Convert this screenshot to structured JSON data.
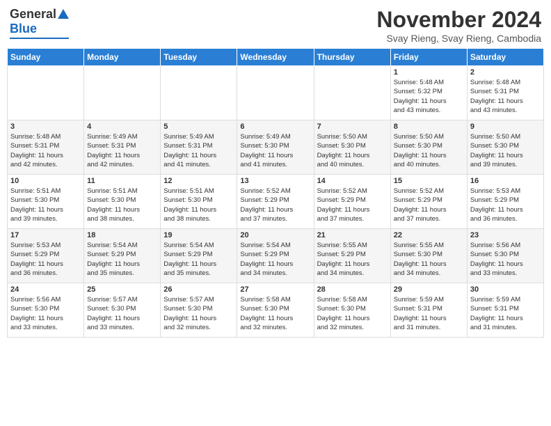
{
  "header": {
    "logo_general": "General",
    "logo_blue": "Blue",
    "month_title": "November 2024",
    "location": "Svay Rieng, Svay Rieng, Cambodia"
  },
  "days_of_week": [
    "Sunday",
    "Monday",
    "Tuesday",
    "Wednesday",
    "Thursday",
    "Friday",
    "Saturday"
  ],
  "weeks": [
    [
      {
        "day": "",
        "info": ""
      },
      {
        "day": "",
        "info": ""
      },
      {
        "day": "",
        "info": ""
      },
      {
        "day": "",
        "info": ""
      },
      {
        "day": "",
        "info": ""
      },
      {
        "day": "1",
        "info": "Sunrise: 5:48 AM\nSunset: 5:32 PM\nDaylight: 11 hours\nand 43 minutes."
      },
      {
        "day": "2",
        "info": "Sunrise: 5:48 AM\nSunset: 5:31 PM\nDaylight: 11 hours\nand 43 minutes."
      }
    ],
    [
      {
        "day": "3",
        "info": "Sunrise: 5:48 AM\nSunset: 5:31 PM\nDaylight: 11 hours\nand 42 minutes."
      },
      {
        "day": "4",
        "info": "Sunrise: 5:49 AM\nSunset: 5:31 PM\nDaylight: 11 hours\nand 42 minutes."
      },
      {
        "day": "5",
        "info": "Sunrise: 5:49 AM\nSunset: 5:31 PM\nDaylight: 11 hours\nand 41 minutes."
      },
      {
        "day": "6",
        "info": "Sunrise: 5:49 AM\nSunset: 5:30 PM\nDaylight: 11 hours\nand 41 minutes."
      },
      {
        "day": "7",
        "info": "Sunrise: 5:50 AM\nSunset: 5:30 PM\nDaylight: 11 hours\nand 40 minutes."
      },
      {
        "day": "8",
        "info": "Sunrise: 5:50 AM\nSunset: 5:30 PM\nDaylight: 11 hours\nand 40 minutes."
      },
      {
        "day": "9",
        "info": "Sunrise: 5:50 AM\nSunset: 5:30 PM\nDaylight: 11 hours\nand 39 minutes."
      }
    ],
    [
      {
        "day": "10",
        "info": "Sunrise: 5:51 AM\nSunset: 5:30 PM\nDaylight: 11 hours\nand 39 minutes."
      },
      {
        "day": "11",
        "info": "Sunrise: 5:51 AM\nSunset: 5:30 PM\nDaylight: 11 hours\nand 38 minutes."
      },
      {
        "day": "12",
        "info": "Sunrise: 5:51 AM\nSunset: 5:30 PM\nDaylight: 11 hours\nand 38 minutes."
      },
      {
        "day": "13",
        "info": "Sunrise: 5:52 AM\nSunset: 5:29 PM\nDaylight: 11 hours\nand 37 minutes."
      },
      {
        "day": "14",
        "info": "Sunrise: 5:52 AM\nSunset: 5:29 PM\nDaylight: 11 hours\nand 37 minutes."
      },
      {
        "day": "15",
        "info": "Sunrise: 5:52 AM\nSunset: 5:29 PM\nDaylight: 11 hours\nand 37 minutes."
      },
      {
        "day": "16",
        "info": "Sunrise: 5:53 AM\nSunset: 5:29 PM\nDaylight: 11 hours\nand 36 minutes."
      }
    ],
    [
      {
        "day": "17",
        "info": "Sunrise: 5:53 AM\nSunset: 5:29 PM\nDaylight: 11 hours\nand 36 minutes."
      },
      {
        "day": "18",
        "info": "Sunrise: 5:54 AM\nSunset: 5:29 PM\nDaylight: 11 hours\nand 35 minutes."
      },
      {
        "day": "19",
        "info": "Sunrise: 5:54 AM\nSunset: 5:29 PM\nDaylight: 11 hours\nand 35 minutes."
      },
      {
        "day": "20",
        "info": "Sunrise: 5:54 AM\nSunset: 5:29 PM\nDaylight: 11 hours\nand 34 minutes."
      },
      {
        "day": "21",
        "info": "Sunrise: 5:55 AM\nSunset: 5:29 PM\nDaylight: 11 hours\nand 34 minutes."
      },
      {
        "day": "22",
        "info": "Sunrise: 5:55 AM\nSunset: 5:30 PM\nDaylight: 11 hours\nand 34 minutes."
      },
      {
        "day": "23",
        "info": "Sunrise: 5:56 AM\nSunset: 5:30 PM\nDaylight: 11 hours\nand 33 minutes."
      }
    ],
    [
      {
        "day": "24",
        "info": "Sunrise: 5:56 AM\nSunset: 5:30 PM\nDaylight: 11 hours\nand 33 minutes."
      },
      {
        "day": "25",
        "info": "Sunrise: 5:57 AM\nSunset: 5:30 PM\nDaylight: 11 hours\nand 33 minutes."
      },
      {
        "day": "26",
        "info": "Sunrise: 5:57 AM\nSunset: 5:30 PM\nDaylight: 11 hours\nand 32 minutes."
      },
      {
        "day": "27",
        "info": "Sunrise: 5:58 AM\nSunset: 5:30 PM\nDaylight: 11 hours\nand 32 minutes."
      },
      {
        "day": "28",
        "info": "Sunrise: 5:58 AM\nSunset: 5:30 PM\nDaylight: 11 hours\nand 32 minutes."
      },
      {
        "day": "29",
        "info": "Sunrise: 5:59 AM\nSunset: 5:31 PM\nDaylight: 11 hours\nand 31 minutes."
      },
      {
        "day": "30",
        "info": "Sunrise: 5:59 AM\nSunset: 5:31 PM\nDaylight: 11 hours\nand 31 minutes."
      }
    ]
  ]
}
